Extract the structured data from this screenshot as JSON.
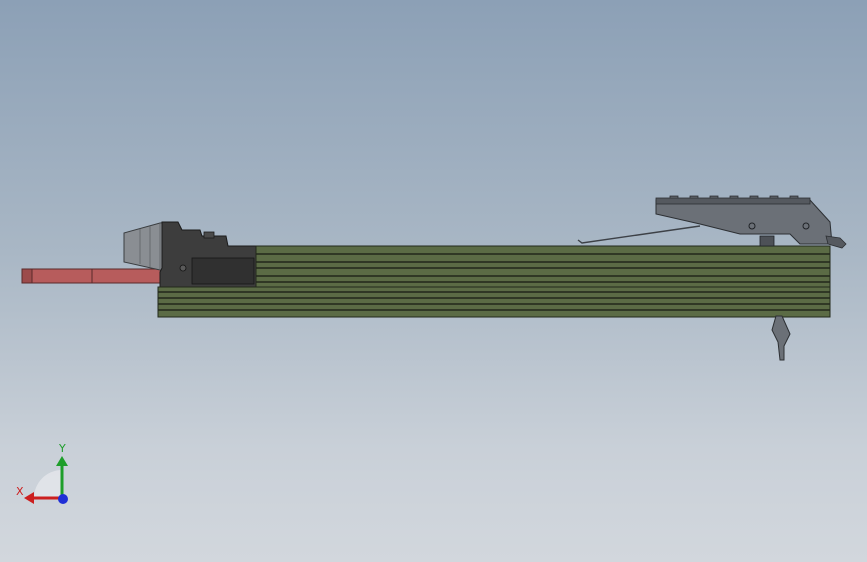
{
  "viewport": {
    "background_top": "#8ca0b6",
    "background_bottom": "#d2d7dd"
  },
  "model": {
    "receiver_color": "#5b6b45",
    "receiver_stripe_color": "#22281b",
    "block_color": "#3a3a3a",
    "buffer_color": "#8a8e93",
    "rail_color": "#6b7077",
    "stock_color": "#b75c5c"
  },
  "triad": {
    "x_label": "X",
    "y_label": "Y",
    "x_color": "#cc1f1f",
    "y_color": "#1e9e2a",
    "z_color": "#1f2fd6"
  }
}
